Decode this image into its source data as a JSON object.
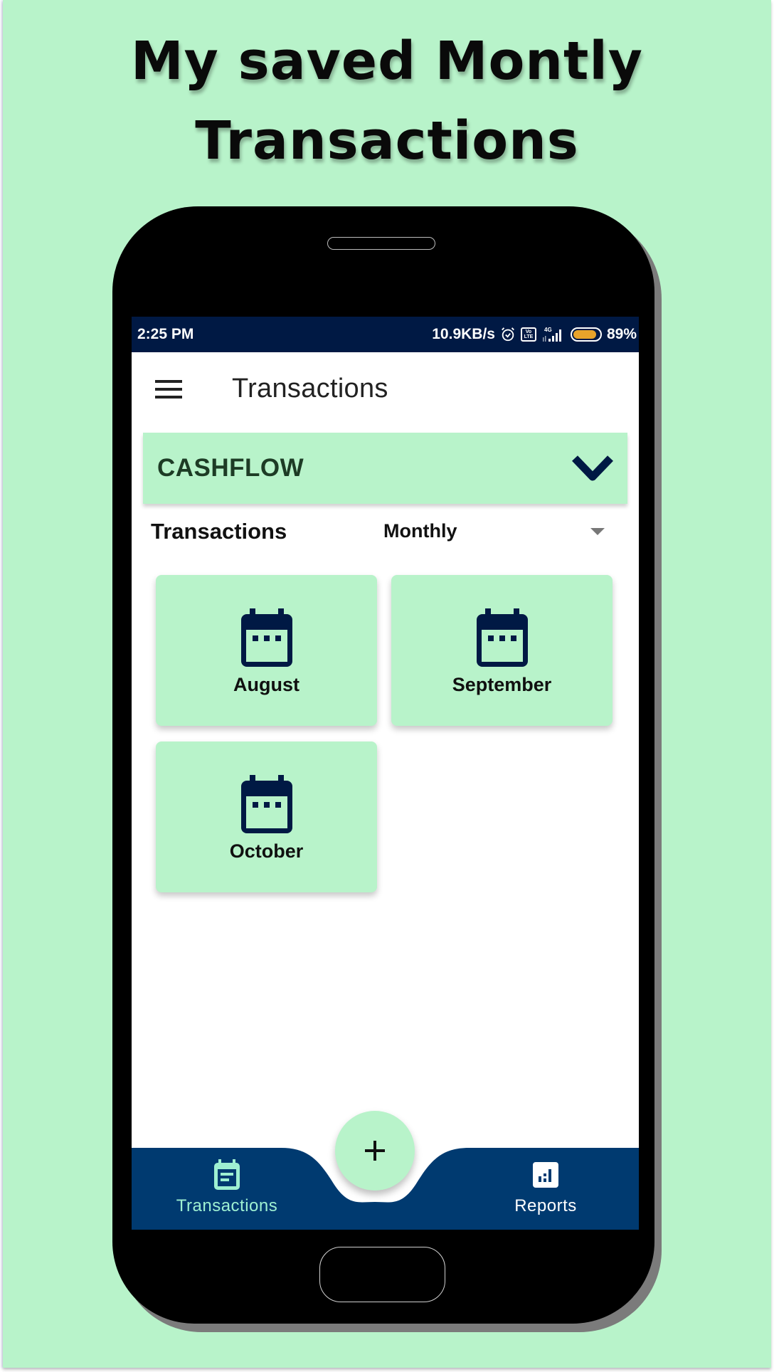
{
  "headline": {
    "line1": "My saved Montly",
    "line2": "Transactions"
  },
  "colors": {
    "background": "#b8f3ca",
    "status_bar": "#001944",
    "bottom_nav": "#003a70",
    "card": "#b8f3ca",
    "icon_navy": "#001944",
    "active_nav": "#9ef0d2",
    "battery": "#e8a32a"
  },
  "status_bar": {
    "time": "2:25 PM",
    "network_speed": "10.9KB/s",
    "icons": [
      "alarm-icon",
      "volte-icon",
      "signal-4g-icon",
      "battery-icon"
    ],
    "volte_top": "Vo",
    "volte_bottom": "LTE",
    "network_type": "4G",
    "battery_percent": "89%",
    "battery_level": 0.89
  },
  "app_bar": {
    "menu_icon": "hamburger-menu-icon",
    "title": "Transactions"
  },
  "section": {
    "title": "CASHFLOW",
    "toggle_icon": "chevron-down-icon"
  },
  "filter": {
    "label": "Transactions",
    "period_selected": "Monthly",
    "dropdown_icon": "dropdown-arrow-icon"
  },
  "months": [
    {
      "label": "August",
      "icon": "calendar-icon"
    },
    {
      "label": "September",
      "icon": "calendar-icon"
    },
    {
      "label": "October",
      "icon": "calendar-icon"
    }
  ],
  "fab": {
    "icon": "plus-icon"
  },
  "bottom_nav": {
    "items": [
      {
        "label": "Transactions",
        "icon": "calendar-list-icon",
        "active": true
      },
      {
        "label": "Reports",
        "icon": "bar-chart-icon",
        "active": false
      }
    ]
  }
}
